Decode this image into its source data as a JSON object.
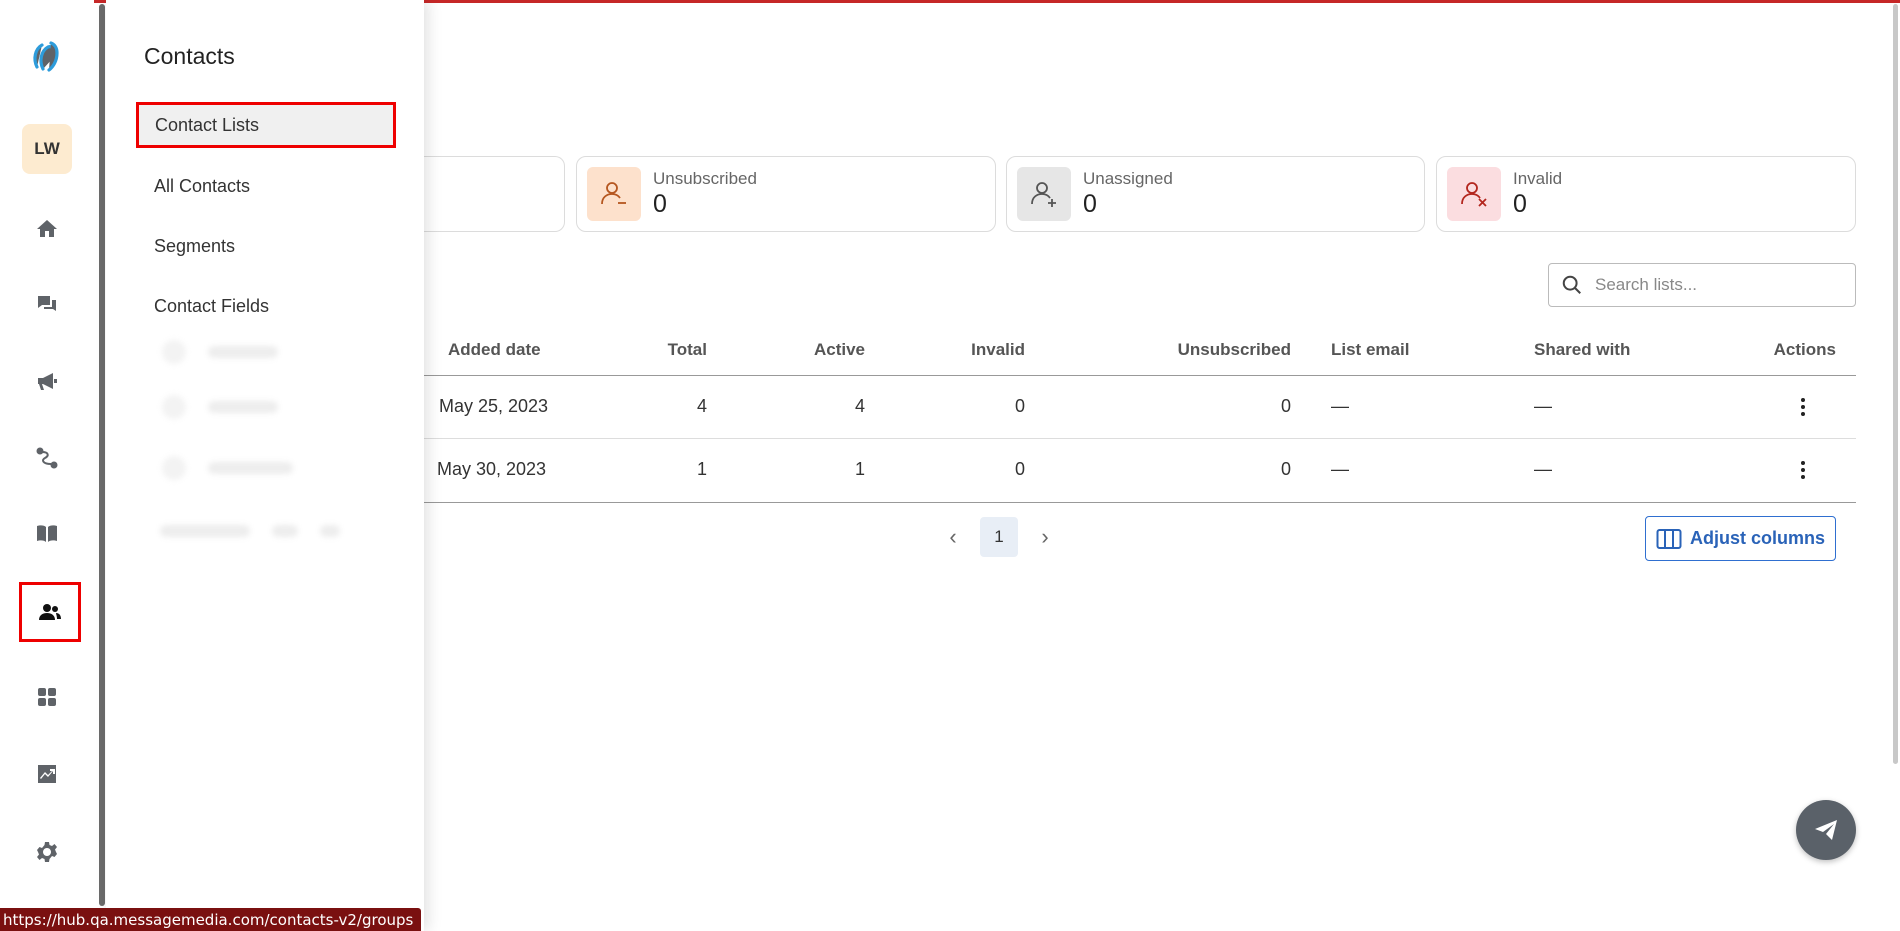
{
  "submenu": {
    "title": "Contacts",
    "items": [
      {
        "label": "Contact Lists",
        "selected": true
      },
      {
        "label": "All Contacts"
      },
      {
        "label": "Segments"
      },
      {
        "label": "Contact Fields"
      }
    ]
  },
  "user": {
    "initials": "LW"
  },
  "nav": [
    "home-icon",
    "chat-icon",
    "megaphone-icon",
    "route-icon",
    "book-icon",
    "contacts-icon",
    "apps-icon",
    "analytics-icon",
    "settings-icon"
  ],
  "stats": [
    {
      "label": "Unsubscribed",
      "value": "0",
      "color": "#fde1cc"
    },
    {
      "label": "Unassigned",
      "value": "0",
      "color": "#e6e6e6"
    },
    {
      "label": "Invalid",
      "value": "0",
      "color": "#fbdde0"
    }
  ],
  "search": {
    "placeholder": "Search lists..."
  },
  "table": {
    "columns": [
      "Added date",
      "Total",
      "Active",
      "Invalid",
      "Unsubscribed",
      "List email",
      "Shared with",
      "Actions"
    ],
    "rows": [
      {
        "added": "May 25, 2023",
        "total": "4",
        "active": "4",
        "invalid": "0",
        "unsubscribed": "0",
        "email": "—",
        "shared": "—"
      },
      {
        "added": "May 30, 2023",
        "total": "1",
        "active": "1",
        "invalid": "0",
        "unsubscribed": "0",
        "email": "—",
        "shared": "—"
      }
    ]
  },
  "pagination": {
    "current": "1"
  },
  "adjust_columns": "Adjust columns",
  "status_url": "https://hub.qa.messagemedia.com/contacts-v2/groups",
  "colors": {
    "accent": "#2f6fd0",
    "highlight": "#e00000"
  }
}
